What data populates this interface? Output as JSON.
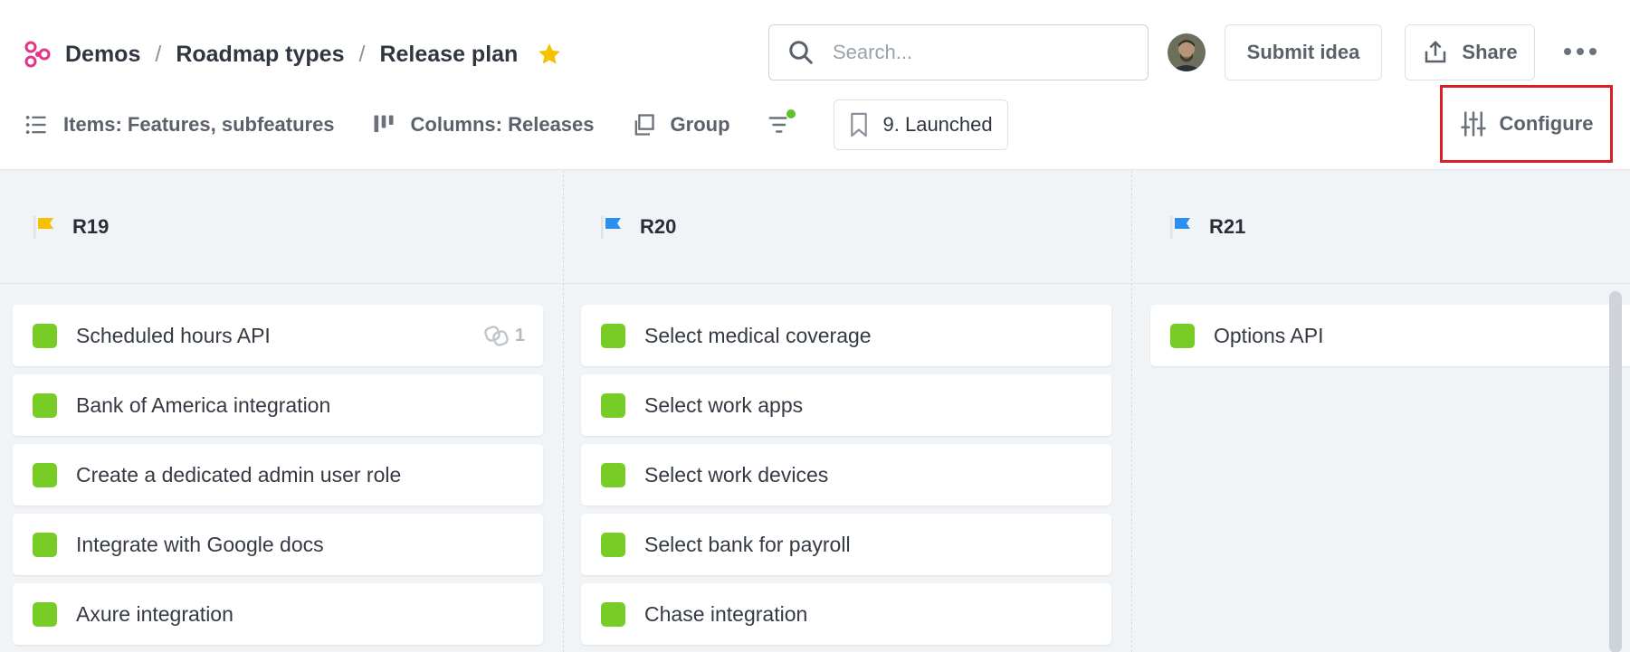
{
  "breadcrumb": {
    "items": [
      "Demos",
      "Roadmap types",
      "Release plan"
    ],
    "separator": "/"
  },
  "search": {
    "placeholder": "Search..."
  },
  "header": {
    "submit_label": "Submit idea",
    "share_label": "Share"
  },
  "toolbar": {
    "items_label": "Items: Features, subfeatures",
    "columns_label": "Columns: Releases",
    "group_label": "Group",
    "view_label": "9. Launched",
    "configure_label": "Configure"
  },
  "colors": {
    "release_yellow": "#f6c200",
    "release_blue": "#2a8ff0",
    "status_green": "#78cc26",
    "highlight_red": "#d81f26"
  },
  "columns": [
    {
      "title": "R19",
      "flag_color": "#f6c200",
      "cards": [
        {
          "label": "Scheduled hours API",
          "link_count": "1"
        },
        {
          "label": "Bank of America integration"
        },
        {
          "label": "Create a dedicated admin user role"
        },
        {
          "label": "Integrate with Google docs"
        },
        {
          "label": "Axure integration"
        }
      ]
    },
    {
      "title": "R20",
      "flag_color": "#2a8ff0",
      "cards": [
        {
          "label": "Select medical coverage"
        },
        {
          "label": "Select work apps"
        },
        {
          "label": "Select work devices"
        },
        {
          "label": "Select bank for payroll"
        },
        {
          "label": "Chase integration"
        }
      ]
    },
    {
      "title": "R21",
      "flag_color": "#2a8ff0",
      "cards": [
        {
          "label": "Options API"
        }
      ]
    }
  ]
}
